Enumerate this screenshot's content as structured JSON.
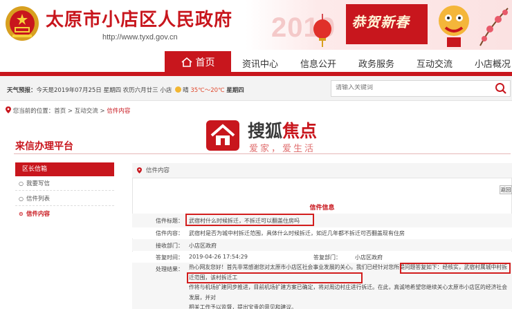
{
  "header": {
    "site_title": "太原市小店区人民政府",
    "site_url": "http://www.tyxd.gov.cn",
    "banner_text": "恭贺新春",
    "banner_year": "2019"
  },
  "nav": {
    "home": "首页",
    "items": [
      "资讯中心",
      "信息公开",
      "政务服务",
      "互动交流",
      "小店概况"
    ]
  },
  "infobar": {
    "weather_label": "天气预报：",
    "date_text": "今天是2019年07月25日 星期四 农历六月廿三",
    "city": "小店",
    "weather_cond": "晴",
    "temp_range": "35℃～20℃",
    "weekday": "星期四",
    "search_placeholder": "请输入关键词"
  },
  "breadcrumb": {
    "prefix": "您当前的位置：",
    "home": "首页",
    "sep1": " > ",
    "section": "互动交流",
    "sep2": " > ",
    "current": "信件内容"
  },
  "watermark": {
    "brand_dark": "搜狐",
    "brand_red": "焦点",
    "slogan": "爱家，爱生活"
  },
  "platform_title": "来信办理平台",
  "sidebar": {
    "heading": "区长信箱",
    "items": [
      {
        "label": "我要写信"
      },
      {
        "label": "信件列表"
      },
      {
        "label": "信件内容"
      }
    ]
  },
  "panel": {
    "heading": "信件内容",
    "back": "返回",
    "detail_title": "信件信息",
    "rows": {
      "title_label": "信件标题：",
      "title_value": "武宿村什么时候拆迁，不拆迁可以翻盖住房吗",
      "content_label": "信件内容：",
      "content_value": "武宿村是否为城中村拆迁范围，具体什么时候拆迁，如近几年都不拆迁可否翻盖现有住房",
      "receiver_label": "接收部门：",
      "receiver_value": "小店区政府",
      "time_label": "答复时间：",
      "time_value": "2019-04-26 17:54:29",
      "dept_label": "答复部门：",
      "dept_value": "小店区政府",
      "result_label": "处理结果：",
      "reply_line1": "热心网友您好！首先非常感谢您对太原市小店区社会事业发展的关心。我们已经针对您所提问题答复如下：经核实，武宿村属城中村拆迁范围，该村拆迁工",
      "reply_line2": "作将与机场扩建同步推进，目前机场扩建方案已确定，将对周边村庄进行拆迁。在此，真诚地希望您继续关心太原市小店区的经济社会发展，并对",
      "reply_line3": "相关工作予以监督，提出宝贵的意见和建议。"
    }
  },
  "colors": {
    "brand_red": "#c8161d",
    "highlight_box": "#d21d1d"
  }
}
